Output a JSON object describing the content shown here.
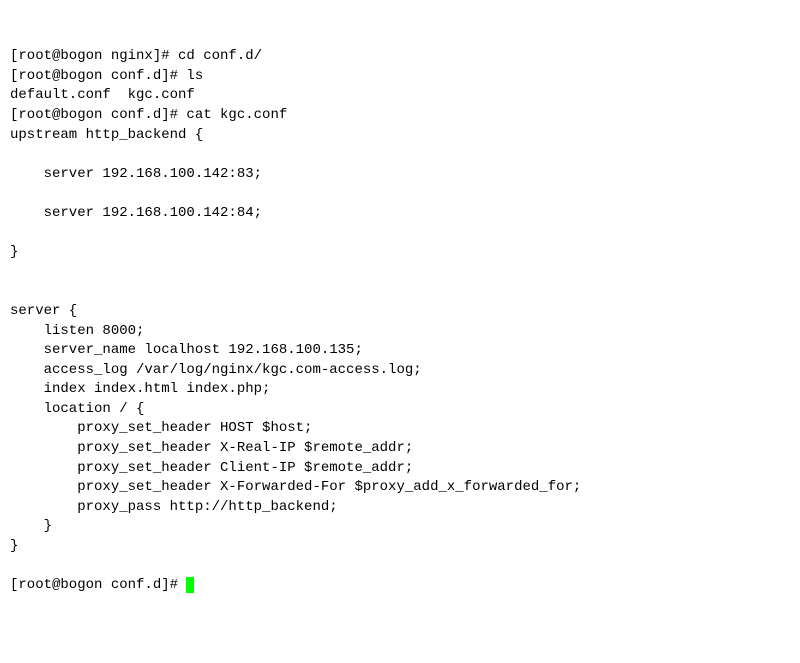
{
  "lines": [
    "[root@bogon nginx]# cd conf.d/",
    "[root@bogon conf.d]# ls",
    "default.conf  kgc.conf",
    "[root@bogon conf.d]# cat kgc.conf",
    "upstream http_backend {",
    "",
    "    server 192.168.100.142:83;",
    "",
    "    server 192.168.100.142:84;",
    "",
    "}",
    "",
    "",
    "server {",
    "    listen 8000;",
    "    server_name localhost 192.168.100.135;",
    "    access_log /var/log/nginx/kgc.com-access.log;",
    "    index index.html index.php;",
    "    location / {",
    "        proxy_set_header HOST $host;",
    "        proxy_set_header X-Real-IP $remote_addr;",
    "        proxy_set_header Client-IP $remote_addr;",
    "        proxy_set_header X-Forwarded-For $proxy_add_x_forwarded_for;",
    "        proxy_pass http://http_backend;",
    "    }",
    "}",
    "",
    "[root@bogon conf.d]# "
  ]
}
